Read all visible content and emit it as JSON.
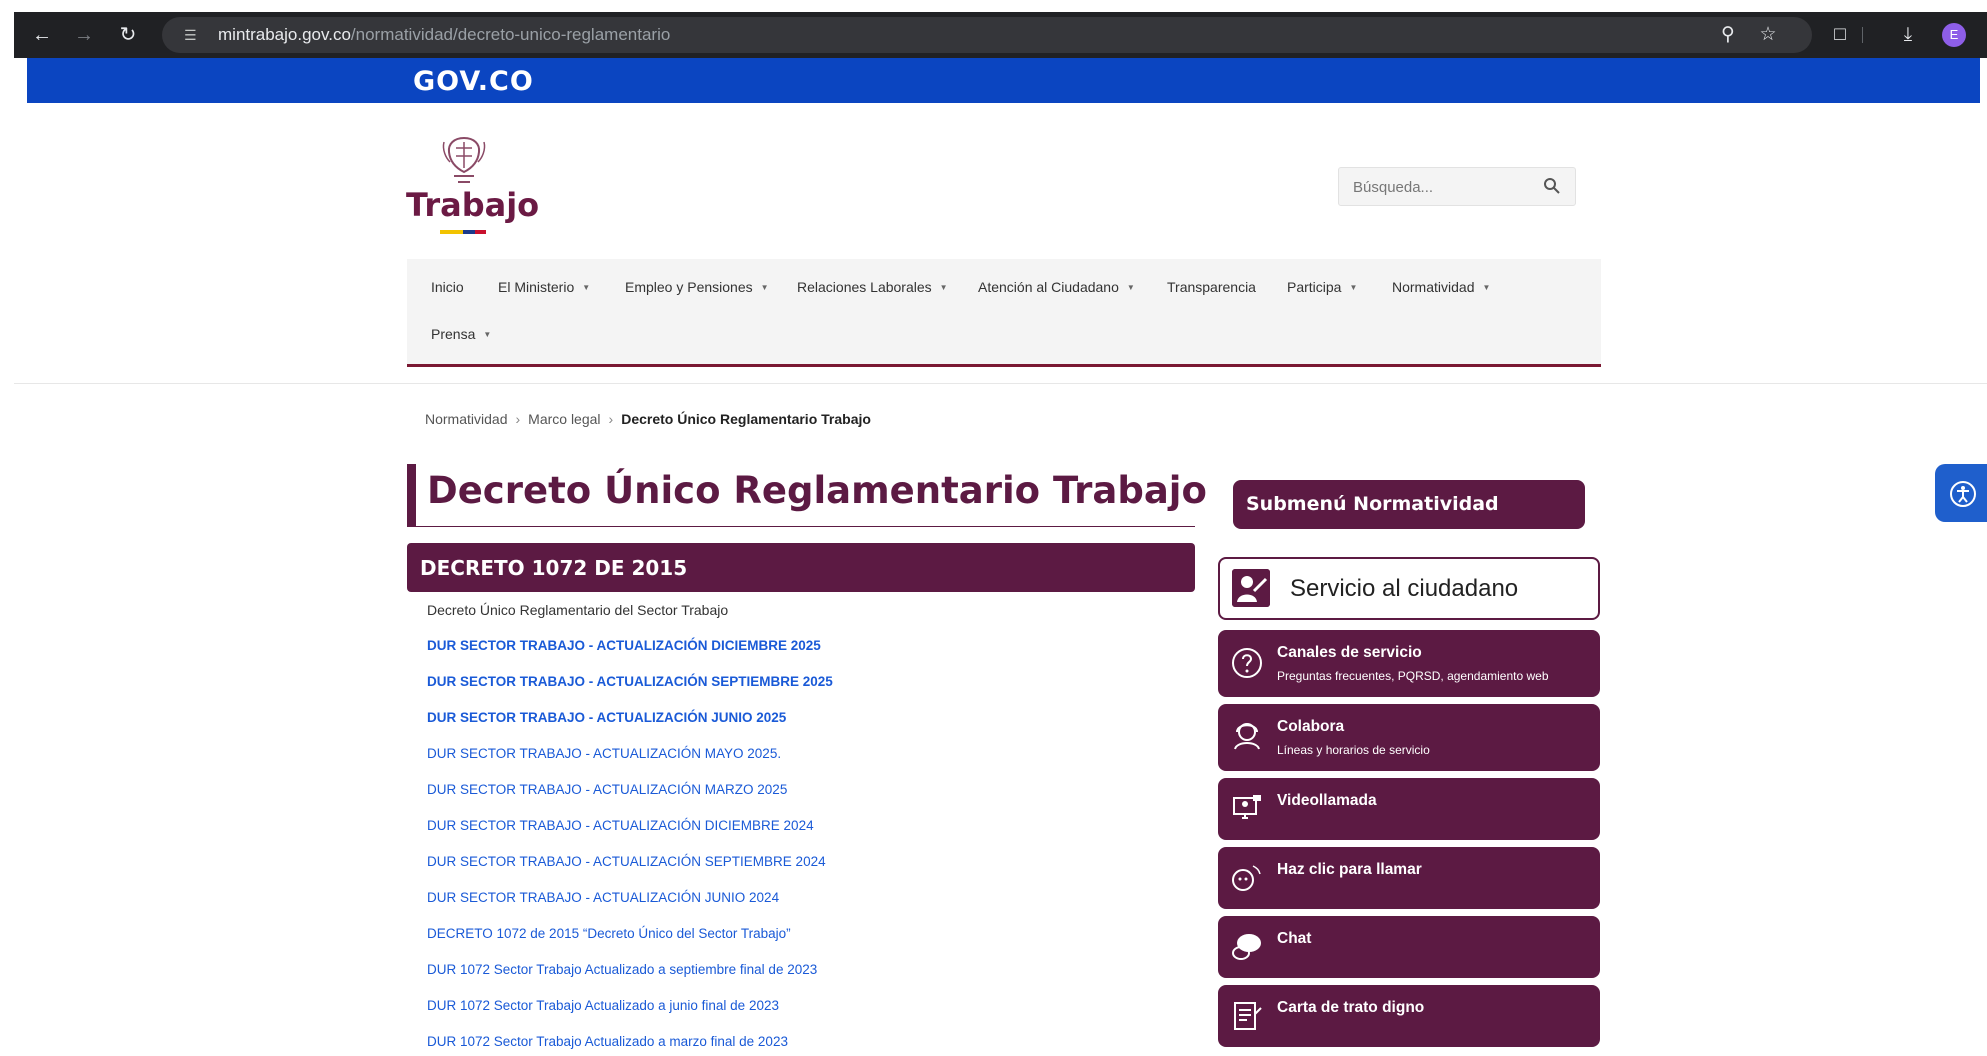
{
  "browser": {
    "url_domain": "mintrabajo.gov.co",
    "url_path": "/normatividad/decreto-unico-reglamentario",
    "profile_initial": "E"
  },
  "gov": {
    "logo": "GOV.CO"
  },
  "header": {
    "logo_text": "Trabajo",
    "search_placeholder": "Búsqueda..."
  },
  "menu": {
    "items": [
      {
        "label": "Inicio"
      },
      {
        "label": "El Ministerio"
      },
      {
        "label": "Empleo y Pensiones"
      },
      {
        "label": "Relaciones Laborales"
      },
      {
        "label": "Atención al Ciudadano"
      },
      {
        "label": "Transparencia"
      },
      {
        "label": "Participa"
      },
      {
        "label": "Normatividad"
      },
      {
        "label": "Prensa"
      }
    ]
  },
  "breadcrumb": {
    "items": [
      "Normatividad",
      "Marco legal"
    ],
    "current": "Decreto Único Reglamentario Trabajo"
  },
  "main": {
    "title": "Decreto Único Reglamentario Trabajo",
    "section_title": "DECRETO 1072 DE 2015",
    "subtitle": "Decreto Único Reglamentario del Sector Trabajo",
    "links": [
      "DUR SECTOR TRABAJO - ACTUALIZACIÓN DICIEMBRE 2025",
      "DUR SECTOR TRABAJO - ACTUALIZACIÓN SEPTIEMBRE 2025",
      "DUR SECTOR TRABAJO - ACTUALIZACIÓN JUNIO 2025",
      "DUR SECTOR TRABAJO - ACTUALIZACIÓN MAYO 2025.",
      "DUR SECTOR TRABAJO - ACTUALIZACIÓN MARZO 2025",
      "DUR SECTOR TRABAJO - ACTUALIZACIÓN DICIEMBRE 2024",
      "DUR SECTOR TRABAJO - ACTUALIZACIÓN SEPTIEMBRE 2024",
      "DUR SECTOR TRABAJO - ACTUALIZACIÓN JUNIO 2024",
      "DECRETO 1072 de 2015 “Decreto Único del Sector Trabajo”",
      "DUR 1072 Sector Trabajo Actualizado a septiembre  final de 2023",
      "DUR 1072 Sector Trabajo Actualizado a junio  final de 2023",
      "DUR 1072 Sector Trabajo Actualizado a marzo  final de 2023"
    ]
  },
  "sidebar": {
    "submenu_title": "Submenú Normatividad",
    "service_header": "Servicio al ciudadano",
    "services": [
      {
        "label": "Canales de servicio",
        "sub": "Preguntas frecuentes, PQRSD, agendamiento web",
        "icon": "question-icon"
      },
      {
        "label": "Colabora",
        "sub": "Líneas y horarios de servicio",
        "icon": "agent-icon"
      },
      {
        "label": "Videollamada",
        "sub": "",
        "icon": "video-call-icon"
      },
      {
        "label": "Haz clic para llamar",
        "sub": "",
        "icon": "call-icon"
      },
      {
        "label": "Chat",
        "sub": "",
        "icon": "chat-icon"
      },
      {
        "label": "Carta de trato digno",
        "sub": "",
        "icon": "document-icon"
      }
    ]
  },
  "colors": {
    "gov_blue": "#0b45c1",
    "brand_purple": "#5c1a43",
    "link_blue": "#1a5ad7",
    "menu_border": "#7a1832"
  }
}
